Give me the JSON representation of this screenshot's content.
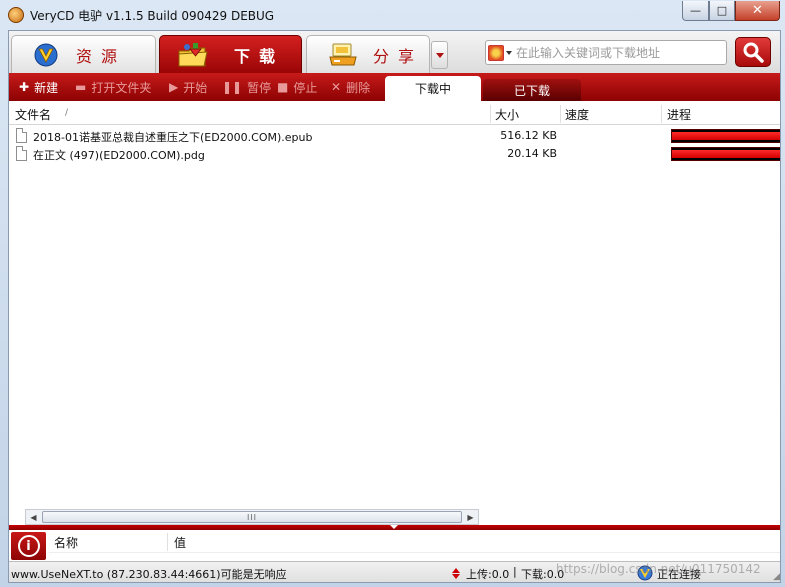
{
  "window": {
    "title": "VeryCD 电驴 v1.1.5 Build 090429 DEBUG",
    "buttons": {
      "minimize": "—",
      "maximize": "□",
      "close": "✕"
    }
  },
  "main_tabs": [
    {
      "label": "资源",
      "icon": "globe-v-icon",
      "active": false
    },
    {
      "label": "下载",
      "icon": "folder-download-icon",
      "active": true
    },
    {
      "label": "分享",
      "icon": "share-drive-icon",
      "active": false
    }
  ],
  "search": {
    "placeholder": "在此输入关键词或下载地址",
    "value": ""
  },
  "toolbar": {
    "new": "新建",
    "open_folder": "打开文件夹",
    "start": "开始",
    "pause": "暂停",
    "stop": "停止",
    "delete": "删除"
  },
  "sub_tabs": {
    "downloading": "下载中",
    "downloaded": "已下载"
  },
  "list": {
    "columns": {
      "name": "文件名",
      "sort_marker": "/",
      "size": "大小",
      "speed": "速度",
      "progress": "进程"
    },
    "rows": [
      {
        "name": "2018-01诺基亚总裁自述重压之下(ED2000.COM).epub",
        "size": "516.12 KB",
        "speed": "",
        "progress": 1.0
      },
      {
        "name": "在正文 (497)(ED2000.COM).pdg",
        "size": "20.14 KB",
        "speed": "",
        "progress": 1.0
      }
    ]
  },
  "scrollbar": {
    "left_arrow": "◀",
    "right_arrow": "▶",
    "grip": "III"
  },
  "bottom_panel": {
    "col_name": "名称",
    "col_value": "值",
    "info_glyph": "i"
  },
  "status": {
    "server": "www.UseNeXT.to (87.230.83.44:4661)可能是无响应",
    "upload": "上传:0.0",
    "separator": "|",
    "download": "下载:0.0",
    "connection": "正在连接"
  },
  "watermark": "https://blog.csdn.net/u011750142",
  "colors": {
    "accent_red": "#b01010",
    "toolbar_red": "#c71a1a",
    "progress_red": "#ff2a2a"
  }
}
